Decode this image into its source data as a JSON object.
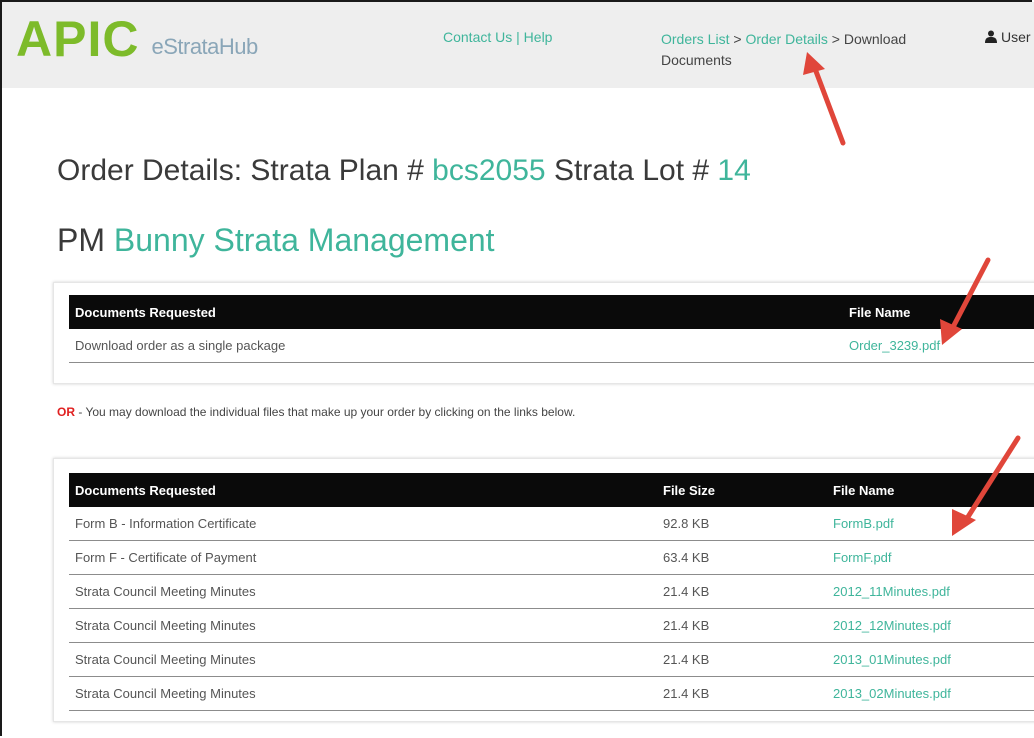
{
  "header": {
    "logo_main": "APIC",
    "logo_sub": "eStrataHub",
    "contact_link": "Contact Us",
    "separator": " | ",
    "help_link": "Help",
    "breadcrumb": {
      "orders_list": "Orders List",
      "sep1": " > ",
      "order_details": "Order Details",
      "sep2": " > ",
      "current": "Download Documents"
    },
    "user_label": "User"
  },
  "order": {
    "prefix": "Order Details:  Strata Plan # ",
    "plan_number": "bcs2055",
    "lot_prefix": "  Strata Lot # ",
    "lot_number": "14",
    "pm_prefix": "PM ",
    "pm_name": "Bunny Strata Management"
  },
  "package_table": {
    "headers": [
      "Documents Requested",
      "File Name"
    ],
    "rows": [
      {
        "document": "Download order as a single package",
        "file": "Order_3239.pdf"
      }
    ]
  },
  "or_notice": {
    "or_word": "OR",
    "text": " - You may download the individual files that make up your order by clicking on the links below."
  },
  "files_table": {
    "headers": [
      "Documents Requested",
      "File Size",
      "File Name"
    ],
    "rows": [
      {
        "document": "Form B - Information Certificate",
        "size": "92.8 KB",
        "file": "FormB.pdf"
      },
      {
        "document": "Form F - Certificate of Payment",
        "size": "63.4 KB",
        "file": "FormF.pdf"
      },
      {
        "document": "Strata Council Meeting Minutes",
        "size": "21.4 KB",
        "file": "2012_11Minutes.pdf"
      },
      {
        "document": "Strata Council Meeting Minutes",
        "size": "21.4 KB",
        "file": "2012_12Minutes.pdf"
      },
      {
        "document": "Strata Council Meeting Minutes",
        "size": "21.4 KB",
        "file": "2013_01Minutes.pdf"
      },
      {
        "document": "Strata Council Meeting Minutes",
        "size": "21.4 KB",
        "file": "2013_02Minutes.pdf"
      }
    ]
  },
  "colors": {
    "accent_teal": "#3fb59b",
    "logo_green": "#7dbb2a",
    "or_red": "#e02020",
    "annotation_arrow": "#e0463a"
  }
}
